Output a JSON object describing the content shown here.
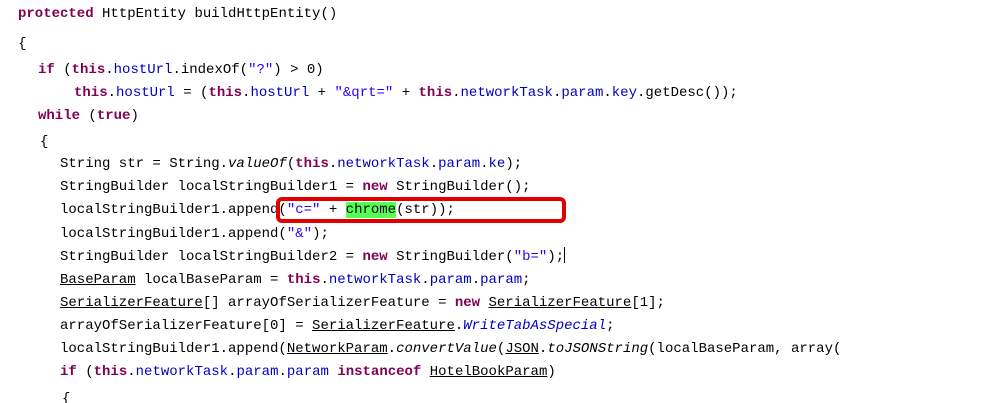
{
  "code": {
    "l1": {
      "kw": "protected",
      "sig": " HttpEntity buildHttpEntity()"
    },
    "l2": {
      "brace": "{"
    },
    "l3": {
      "kw": "if",
      "p1": " (",
      "this": "this",
      "p2": ".",
      "fld": "hostUrl",
      "p3": ".indexOf(",
      "str": "\"?\"",
      "p4": ") > 0)"
    },
    "l4": {
      "this1": "this",
      "dot1": ".",
      "fld1": "hostUrl",
      "p1": " = (",
      "this2": "this",
      "dot2": ".",
      "fld2": "hostUrl",
      "p2": " + ",
      "str": "\"&qrt=\"",
      "p3": " + ",
      "this3": "this",
      "dot3": ".",
      "fld3": "networkTask",
      "dot4": ".",
      "fld4": "param",
      "dot5": ".",
      "fld5": "key",
      "p4": ".getDesc());"
    },
    "l5": {
      "kw": "while",
      "p1": " (",
      "kw2": "true",
      "p2": ")"
    },
    "l6": {
      "brace": "{"
    },
    "l7": {
      "p1": "String str = String.",
      "ital": "valueOf",
      "p2": "(",
      "this": "this",
      "dot1": ".",
      "fld1": "networkTask",
      "dot2": ".",
      "fld2": "param",
      "dot3": ".",
      "fld3": "ke",
      "p3": ");"
    },
    "l8": {
      "p1": "StringBuilder localStringBuilder1 = ",
      "kw": "new",
      "p2": " StringBuilder();"
    },
    "l9": {
      "p1": "localStringBuilder1.append(",
      "str": "\"c=\"",
      "p2": " + ",
      "hl": "chrome",
      "p3": "(str));"
    },
    "l10": {
      "p1": "localStringBuilder1.append(",
      "str": "\"&\"",
      "p2": ");"
    },
    "l11": {
      "p1": "StringBuilder localStringBuilder2 = ",
      "kw": "new",
      "p2": " StringBuilder(",
      "str": "\"b=\"",
      "p3": ");"
    },
    "l12": {
      "cls": "BaseParam",
      "p1": " localBaseParam = ",
      "this": "this",
      "dot1": ".",
      "fld1": "networkTask",
      "dot2": ".",
      "fld2": "param",
      "dot3": ".",
      "fld3": "param",
      "p2": ";"
    },
    "l13": {
      "cls1": "SerializerFeature",
      "p1": "[] arrayOfSerializerFeature = ",
      "kw": "new",
      "p2": " ",
      "cls2": "SerializerFeature",
      "p3": "[1];"
    },
    "l14": {
      "p1": "arrayOfSerializerFeature[0] = ",
      "cls": "SerializerFeature",
      "p2": ".",
      "ital": "WriteTabAsSpecial",
      "p3": ";"
    },
    "l15": {
      "p1": "localStringBuilder1.append(",
      "cls1": "NetworkParam",
      "p2": ".",
      "ital1": "convertValue",
      "p3": "(",
      "cls2": "JSON",
      "p4": ".",
      "ital2": "toJSONString",
      "p5": "(localBaseParam, array("
    },
    "l16": {
      "kw": "if",
      "p1": " (",
      "this": "this",
      "dot1": ".",
      "fld1": "networkTask",
      "dot2": ".",
      "fld2": "param",
      "dot3": ".",
      "fld3": "param",
      "p2": " ",
      "kw2": "instanceof",
      "p3": " ",
      "cls": "HotelBookParam",
      "p4": ")"
    },
    "l17": {
      "brace": "{"
    }
  },
  "colors": {
    "keyword": "#7f0055",
    "field": "#0000c0",
    "string": "#2a00ff",
    "highlight": "#55ff55",
    "annotation_box": "#e00000"
  }
}
